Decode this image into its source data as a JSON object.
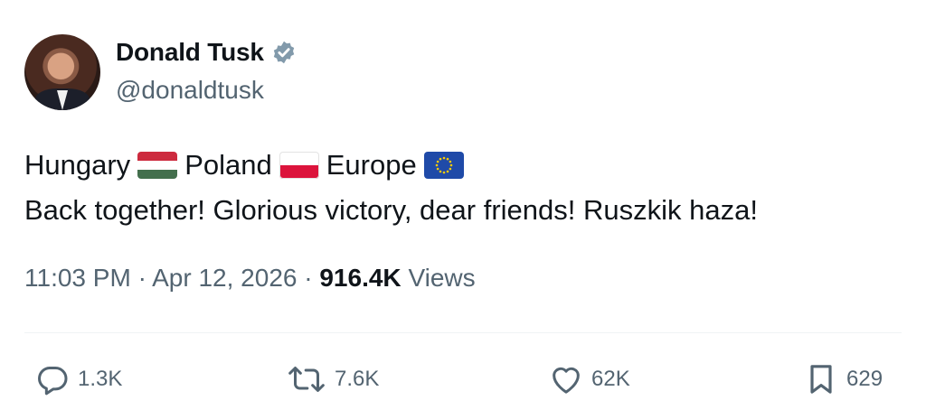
{
  "author": {
    "name": "Donald Tusk",
    "handle": "@donaldtusk",
    "verified_icon": "verified-badge-icon"
  },
  "tweet": {
    "line1": [
      {
        "text": "Hungary",
        "flag": "hungary-flag-icon"
      },
      {
        "text": "Poland",
        "flag": "poland-flag-icon"
      },
      {
        "text": "Europe",
        "flag": "eu-flag-icon"
      }
    ],
    "line2": "Back together!  Glorious victory, dear friends! Ruszkik haza!"
  },
  "meta": {
    "time": "11:03 PM",
    "separator": "·",
    "date": "Apr 12, 2026",
    "views_count": "916.4K",
    "views_label": "Views"
  },
  "actions": {
    "replies": "1.3K",
    "reposts": "7.6K",
    "likes": "62K",
    "bookmarks": "629"
  },
  "colors": {
    "text": "#0f1419",
    "secondary": "#536471",
    "verified": "#829aab"
  }
}
